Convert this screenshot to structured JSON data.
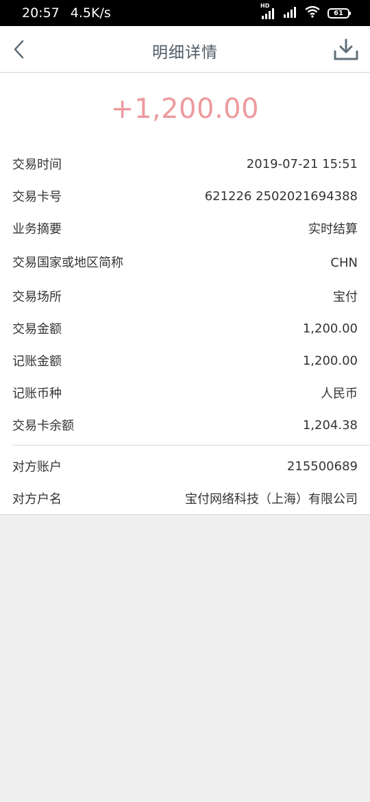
{
  "status_bar": {
    "time": "20:57",
    "speed": "4.5K/s",
    "hd": "HD",
    "battery": "61"
  },
  "nav": {
    "title": "明细详情"
  },
  "amount": "+1,200.00",
  "details": [
    {
      "label": "交易时间",
      "value": "2019-07-21 15:51"
    },
    {
      "label": "交易卡号",
      "value": "621226 2502021694388"
    },
    {
      "label": "业务摘要",
      "value": "实时结算"
    },
    {
      "label": "交易国家或地区简称",
      "value": "CHN"
    },
    {
      "label": "交易场所",
      "value": "宝付"
    },
    {
      "label": "交易金额",
      "value": "1,200.00"
    },
    {
      "label": "记账金额",
      "value": "1,200.00"
    },
    {
      "label": "记账币种",
      "value": "人民币"
    },
    {
      "label": "交易卡余额",
      "value": "1,204.38"
    }
  ],
  "counterparty": [
    {
      "label": "对方账户",
      "value": "215500689"
    },
    {
      "label": "对方户名",
      "value": "宝付网络科技（上海）有限公司"
    }
  ],
  "colors": {
    "amount": "#ec9a9e",
    "title": "#4f5b66",
    "icon": "#5f6f7a"
  }
}
